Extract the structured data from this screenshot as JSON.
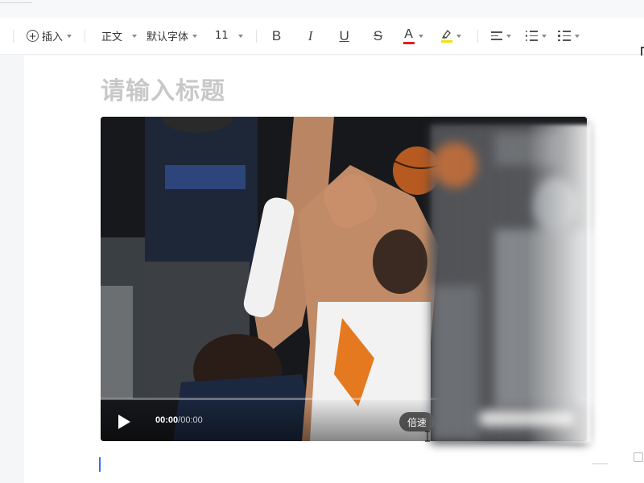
{
  "toolbar": {
    "insert_label": "插入",
    "paragraph_style": "正文",
    "font_family": "默认字体",
    "font_size": "11",
    "bold_label": "B",
    "italic_label": "I",
    "underline_label": "U",
    "strike_label": "S",
    "font_color_label": "A",
    "font_color": "#e02020",
    "highlight_color": "#f5e10a"
  },
  "document": {
    "title_placeholder": "请输入标题"
  },
  "video": {
    "current_time": "00:00",
    "separator": "/",
    "total_time": "00:00",
    "speed_label": "倍速",
    "progress": 0
  },
  "colors": {
    "accent": "#3a6ee8",
    "title_placeholder": "#c8c8c8"
  }
}
